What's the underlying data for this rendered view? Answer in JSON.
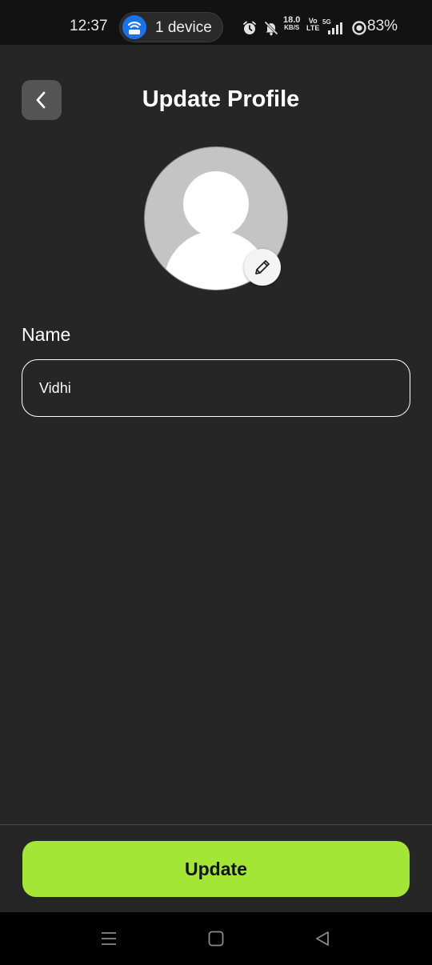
{
  "status_bar": {
    "time": "12:37",
    "hotspot_label": "1 device",
    "speed_value": "18.0",
    "speed_unit": "KB/S",
    "volte_top": "Vo",
    "volte_bottom": "LTE",
    "network": "5G",
    "battery": "83%"
  },
  "header": {
    "title": "Update Profile"
  },
  "form": {
    "name_label": "Name",
    "name_value": "Vidhi"
  },
  "actions": {
    "update_label": "Update"
  },
  "colors": {
    "background": "#262626",
    "accent": "#a3e635",
    "back_button_bg": "#545454"
  }
}
